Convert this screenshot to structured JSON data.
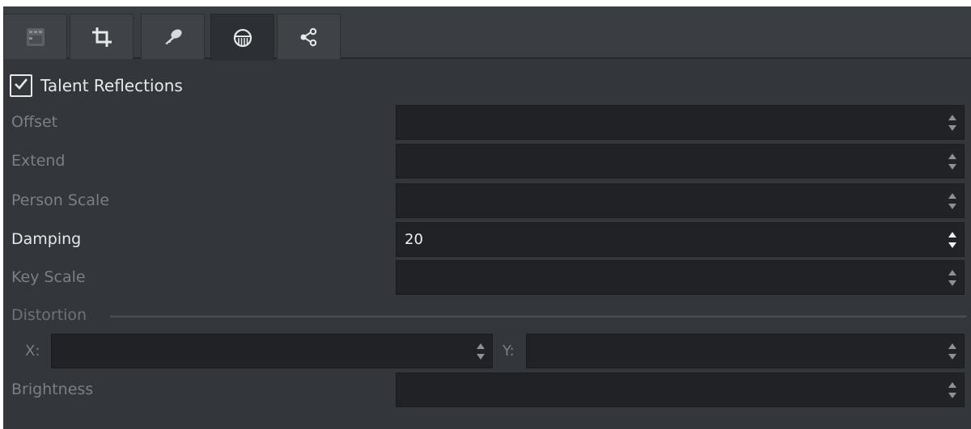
{
  "tabs": [
    {
      "icon": "film-icon",
      "active": false
    },
    {
      "icon": "crop-icon",
      "active": false
    },
    {
      "icon": "key-icon",
      "active": false
    },
    {
      "icon": "reflection-icon",
      "active": true
    },
    {
      "icon": "share-nodes-icon",
      "active": false
    }
  ],
  "talent_reflections": {
    "label": "Talent Reflections",
    "checked": true
  },
  "fields": {
    "offset": {
      "label": "Offset",
      "value": ""
    },
    "extend": {
      "label": "Extend",
      "value": ""
    },
    "person_scale": {
      "label": "Person Scale",
      "value": ""
    },
    "damping": {
      "label": "Damping",
      "value": "20"
    },
    "key_scale": {
      "label": "Key Scale",
      "value": ""
    }
  },
  "distortion": {
    "title": "Distortion",
    "x_label": "X:",
    "x_value": "",
    "y_label": "Y:",
    "y_value": ""
  },
  "brightness": {
    "label": "Brightness",
    "value": ""
  },
  "colors": {
    "panel_bg": "#33363b",
    "field_bg": "#202226",
    "text_active": "#e6e8ea",
    "text_disabled": "#7b7f86"
  }
}
